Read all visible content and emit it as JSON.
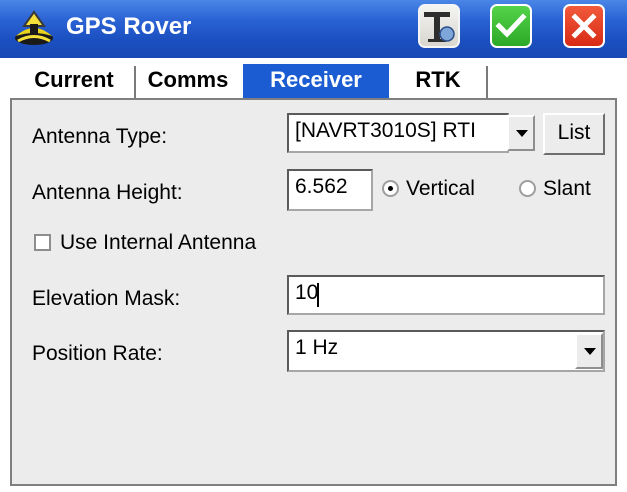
{
  "window": {
    "title": "GPS Rover",
    "title_icon": "gps-rover-icon",
    "buttons": [
      {
        "name": "satellite-receiver-button",
        "icon": "receiver-icon"
      },
      {
        "name": "ok-button",
        "icon": "checkmark-icon",
        "color": "#2ca826"
      },
      {
        "name": "close-button",
        "icon": "x-icon",
        "color": "#d82a16"
      }
    ]
  },
  "tabs": [
    "Current",
    "Comms",
    "Receiver",
    "RTK"
  ],
  "active_tab": "Receiver",
  "form": {
    "antenna_type_label": "Antenna Type:",
    "antenna_type_value": "[NAVRT3010S] RTI",
    "list_button": "List",
    "antenna_height_label": "Antenna Height:",
    "antenna_height_value": "6.562",
    "height_modes": [
      "Vertical",
      "Slant"
    ],
    "height_mode_selected": "Vertical",
    "use_internal_antenna_label": "Use Internal Antenna",
    "use_internal_antenna_checked": false,
    "elevation_mask_label": "Elevation Mask:",
    "elevation_mask_value": "10",
    "position_rate_label": "Position Rate:",
    "position_rate_value": "1 Hz"
  },
  "colors": {
    "titlebar": "#1b4fc0",
    "active_tab": "#1c5cd2",
    "panel": "#ececec"
  }
}
